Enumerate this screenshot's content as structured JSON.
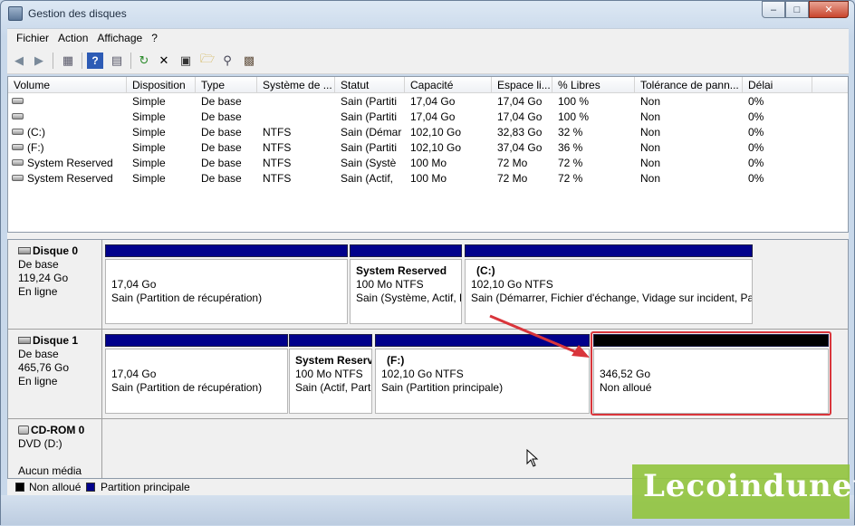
{
  "window": {
    "title": "Gestion des disques"
  },
  "menu": [
    "Fichier",
    "Action",
    "Affichage",
    "?"
  ],
  "volume_table": {
    "columns": [
      "Volume",
      "Disposition",
      "Type",
      "Système de ...",
      "Statut",
      "Capacité",
      "Espace li...",
      "% Libres",
      "Tolérance de pann...",
      "Délai"
    ],
    "rows": [
      [
        "",
        "Simple",
        "De base",
        "",
        "Sain (Partiti",
        "17,04 Go",
        "17,04 Go",
        "100 %",
        "Non",
        "0%"
      ],
      [
        "",
        "Simple",
        "De base",
        "",
        "Sain (Partiti",
        "17,04 Go",
        "17,04 Go",
        "100 %",
        "Non",
        "0%"
      ],
      [
        "(C:)",
        "Simple",
        "De base",
        "NTFS",
        "Sain (Démar",
        "102,10 Go",
        "32,83 Go",
        "32 %",
        "Non",
        "0%"
      ],
      [
        "(F:)",
        "Simple",
        "De base",
        "NTFS",
        "Sain (Partiti",
        "102,10 Go",
        "37,04 Go",
        "36 %",
        "Non",
        "0%"
      ],
      [
        "System Reserved",
        "Simple",
        "De base",
        "NTFS",
        "Sain (Systè",
        "100 Mo",
        "72 Mo",
        "72 %",
        "Non",
        "0%"
      ],
      [
        "System Reserved",
        "Simple",
        "De base",
        "NTFS",
        "Sain (Actif,",
        "100 Mo",
        "72 Mo",
        "72 %",
        "Non",
        "0%"
      ]
    ]
  },
  "disks": [
    {
      "name": "Disque 0",
      "type": "De base",
      "size": "119,24 Go",
      "status": "En ligne",
      "partitions": [
        {
          "name": "",
          "size": "17,04 Go",
          "status": "Sain (Partition de récupération)"
        },
        {
          "name": "System Reserved",
          "size": "100 Mo NTFS",
          "status": "Sain (Système, Actif, Partition principale)"
        },
        {
          "name": "(C:)",
          "size": "102,10 Go NTFS",
          "status": "Sain (Démarrer, Fichier d'échange, Vidage sur incident, Partition principale)"
        }
      ]
    },
    {
      "name": "Disque 1",
      "type": "De base",
      "size": "465,76 Go",
      "status": "En ligne",
      "partitions": [
        {
          "name": "",
          "size": "17,04 Go",
          "status": "Sain (Partition de récupération)"
        },
        {
          "name": "System Reserved",
          "size": "100 Mo NTFS",
          "status": "Sain (Actif, Partition principale)"
        },
        {
          "name": "(F:)",
          "size": "102,10 Go NTFS",
          "status": "Sain (Partition principale)"
        },
        {
          "name": "",
          "size": "346,52 Go",
          "status": "Non alloué"
        }
      ]
    },
    {
      "name": "CD-ROM 0",
      "type": "DVD (D:)",
      "size": "",
      "status": "Aucun média",
      "partitions": []
    }
  ],
  "legend": [
    {
      "label": "Non alloué",
      "color": "#000000"
    },
    {
      "label": "Partition principale",
      "color": "#00008b"
    }
  ],
  "watermark": "Lecoindunet",
  "colors": {
    "primary_partition": "#00008b",
    "unallocated": "#000000",
    "highlight": "#d9353b"
  }
}
